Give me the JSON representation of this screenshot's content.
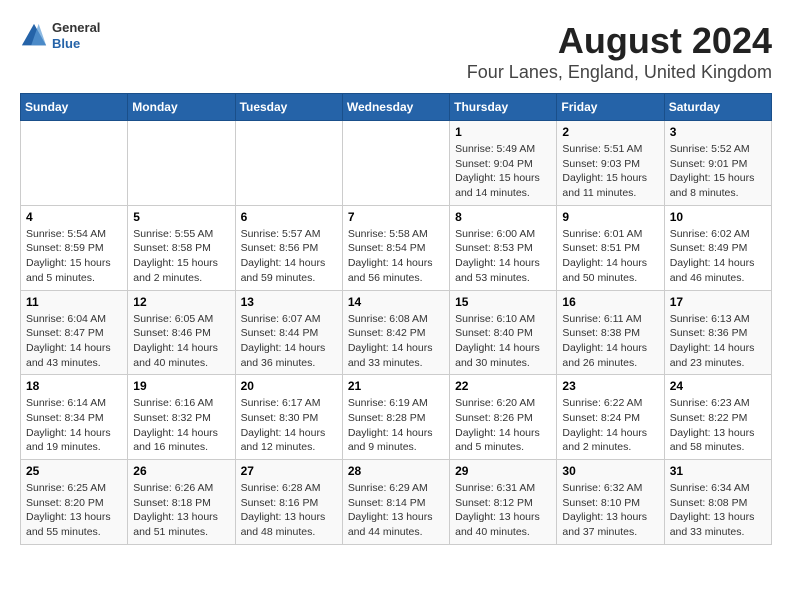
{
  "logo": {
    "line1": "General",
    "line2": "Blue"
  },
  "title": "August 2024",
  "subtitle": "Four Lanes, England, United Kingdom",
  "headers": [
    "Sunday",
    "Monday",
    "Tuesday",
    "Wednesday",
    "Thursday",
    "Friday",
    "Saturday"
  ],
  "weeks": [
    [
      {
        "day": "",
        "info": ""
      },
      {
        "day": "",
        "info": ""
      },
      {
        "day": "",
        "info": ""
      },
      {
        "day": "",
        "info": ""
      },
      {
        "day": "1",
        "info": "Sunrise: 5:49 AM\nSunset: 9:04 PM\nDaylight: 15 hours\nand 14 minutes."
      },
      {
        "day": "2",
        "info": "Sunrise: 5:51 AM\nSunset: 9:03 PM\nDaylight: 15 hours\nand 11 minutes."
      },
      {
        "day": "3",
        "info": "Sunrise: 5:52 AM\nSunset: 9:01 PM\nDaylight: 15 hours\nand 8 minutes."
      }
    ],
    [
      {
        "day": "4",
        "info": "Sunrise: 5:54 AM\nSunset: 8:59 PM\nDaylight: 15 hours\nand 5 minutes."
      },
      {
        "day": "5",
        "info": "Sunrise: 5:55 AM\nSunset: 8:58 PM\nDaylight: 15 hours\nand 2 minutes."
      },
      {
        "day": "6",
        "info": "Sunrise: 5:57 AM\nSunset: 8:56 PM\nDaylight: 14 hours\nand 59 minutes."
      },
      {
        "day": "7",
        "info": "Sunrise: 5:58 AM\nSunset: 8:54 PM\nDaylight: 14 hours\nand 56 minutes."
      },
      {
        "day": "8",
        "info": "Sunrise: 6:00 AM\nSunset: 8:53 PM\nDaylight: 14 hours\nand 53 minutes."
      },
      {
        "day": "9",
        "info": "Sunrise: 6:01 AM\nSunset: 8:51 PM\nDaylight: 14 hours\nand 50 minutes."
      },
      {
        "day": "10",
        "info": "Sunrise: 6:02 AM\nSunset: 8:49 PM\nDaylight: 14 hours\nand 46 minutes."
      }
    ],
    [
      {
        "day": "11",
        "info": "Sunrise: 6:04 AM\nSunset: 8:47 PM\nDaylight: 14 hours\nand 43 minutes."
      },
      {
        "day": "12",
        "info": "Sunrise: 6:05 AM\nSunset: 8:46 PM\nDaylight: 14 hours\nand 40 minutes."
      },
      {
        "day": "13",
        "info": "Sunrise: 6:07 AM\nSunset: 8:44 PM\nDaylight: 14 hours\nand 36 minutes."
      },
      {
        "day": "14",
        "info": "Sunrise: 6:08 AM\nSunset: 8:42 PM\nDaylight: 14 hours\nand 33 minutes."
      },
      {
        "day": "15",
        "info": "Sunrise: 6:10 AM\nSunset: 8:40 PM\nDaylight: 14 hours\nand 30 minutes."
      },
      {
        "day": "16",
        "info": "Sunrise: 6:11 AM\nSunset: 8:38 PM\nDaylight: 14 hours\nand 26 minutes."
      },
      {
        "day": "17",
        "info": "Sunrise: 6:13 AM\nSunset: 8:36 PM\nDaylight: 14 hours\nand 23 minutes."
      }
    ],
    [
      {
        "day": "18",
        "info": "Sunrise: 6:14 AM\nSunset: 8:34 PM\nDaylight: 14 hours\nand 19 minutes."
      },
      {
        "day": "19",
        "info": "Sunrise: 6:16 AM\nSunset: 8:32 PM\nDaylight: 14 hours\nand 16 minutes."
      },
      {
        "day": "20",
        "info": "Sunrise: 6:17 AM\nSunset: 8:30 PM\nDaylight: 14 hours\nand 12 minutes."
      },
      {
        "day": "21",
        "info": "Sunrise: 6:19 AM\nSunset: 8:28 PM\nDaylight: 14 hours\nand 9 minutes."
      },
      {
        "day": "22",
        "info": "Sunrise: 6:20 AM\nSunset: 8:26 PM\nDaylight: 14 hours\nand 5 minutes."
      },
      {
        "day": "23",
        "info": "Sunrise: 6:22 AM\nSunset: 8:24 PM\nDaylight: 14 hours\nand 2 minutes."
      },
      {
        "day": "24",
        "info": "Sunrise: 6:23 AM\nSunset: 8:22 PM\nDaylight: 13 hours\nand 58 minutes."
      }
    ],
    [
      {
        "day": "25",
        "info": "Sunrise: 6:25 AM\nSunset: 8:20 PM\nDaylight: 13 hours\nand 55 minutes."
      },
      {
        "day": "26",
        "info": "Sunrise: 6:26 AM\nSunset: 8:18 PM\nDaylight: 13 hours\nand 51 minutes."
      },
      {
        "day": "27",
        "info": "Sunrise: 6:28 AM\nSunset: 8:16 PM\nDaylight: 13 hours\nand 48 minutes."
      },
      {
        "day": "28",
        "info": "Sunrise: 6:29 AM\nSunset: 8:14 PM\nDaylight: 13 hours\nand 44 minutes."
      },
      {
        "day": "29",
        "info": "Sunrise: 6:31 AM\nSunset: 8:12 PM\nDaylight: 13 hours\nand 40 minutes."
      },
      {
        "day": "30",
        "info": "Sunrise: 6:32 AM\nSunset: 8:10 PM\nDaylight: 13 hours\nand 37 minutes."
      },
      {
        "day": "31",
        "info": "Sunrise: 6:34 AM\nSunset: 8:08 PM\nDaylight: 13 hours\nand 33 minutes."
      }
    ]
  ]
}
